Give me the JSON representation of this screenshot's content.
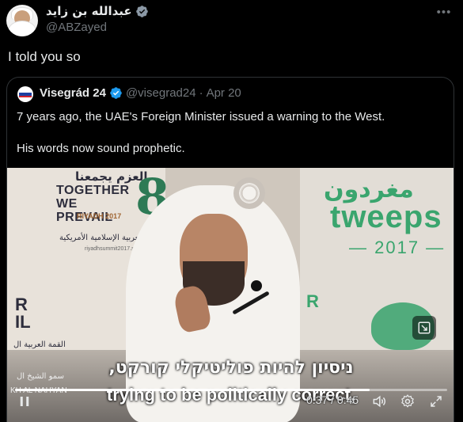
{
  "author": {
    "display_name": "عبدالله بن زايد",
    "handle": "@ABZayed"
  },
  "tweet": {
    "text": "I told you so",
    "more_icon": "more-icon"
  },
  "quoted": {
    "display_name": "Visegrád 24",
    "handle": "@visegrad24",
    "separator": "·",
    "date": "Apr 20",
    "text_line1": "7 years ago, the UAE's Foreign Minister issued a warning to the West.",
    "text_line2": "His words now sound prophetic."
  },
  "video": {
    "backdrop_left_ar": "العزم يجمعنا",
    "backdrop_left_en": "TOGETHER WE PREVAIL",
    "backdrop_riyadh": "RIYADH 2017",
    "backdrop_left_ar_sub": "القمة العربية الإسلامية الأمريكية",
    "backdrop_left_url": "riyadhsummit2017.sa",
    "backdrop_right_ar": "مغردون",
    "backdrop_right_en": "tweeps",
    "backdrop_right_year": "— 2017 —",
    "backdrop_left_partial": "R\nIL",
    "backdrop_left_partial_ar": "القمة العربية ال",
    "backdrop_left_name": "KH AL NAHYAN",
    "backdrop_left_name_ar": "سمو الشيخ ال",
    "backdrop_right_partial": "R",
    "subtitle_hebrew": "ניסיון להיות פוליטיקלי קורקט,",
    "subtitle_english": "trying to be politically correct,",
    "time": "0:37 / 0:45",
    "progress": 0.82
  },
  "colors": {
    "background": "#000000",
    "text": "#e7e9ea",
    "muted": "#71767b",
    "border": "#2f3336",
    "verified": "#1d9bf0"
  }
}
